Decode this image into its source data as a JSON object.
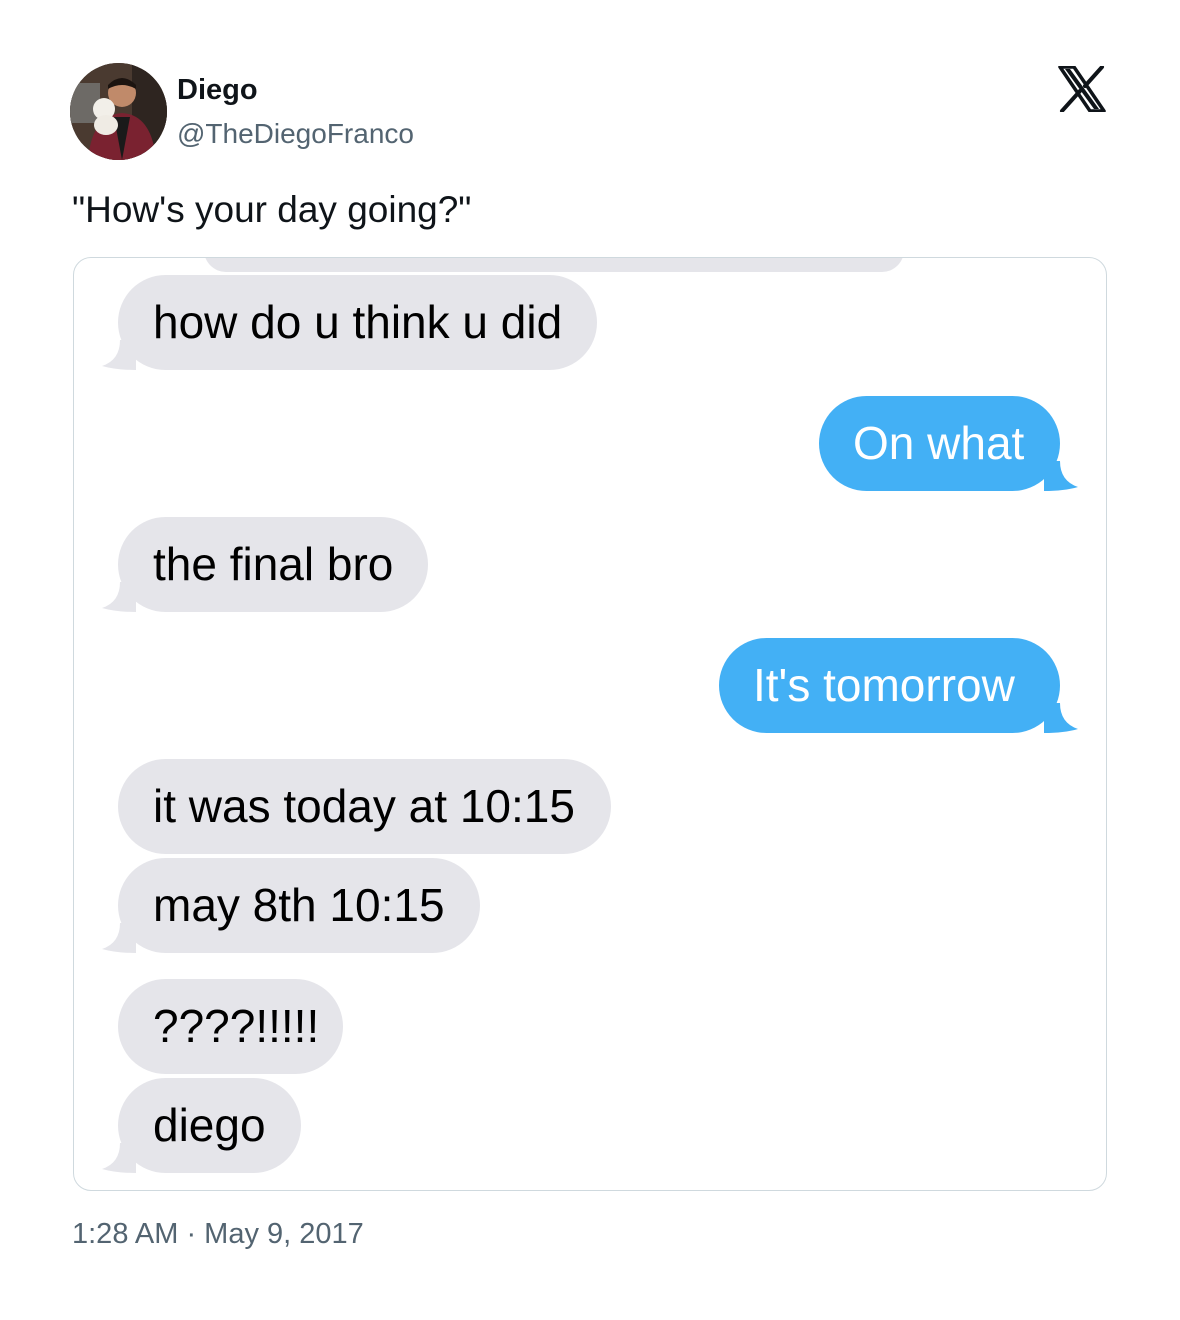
{
  "author": {
    "display_name": "Diego",
    "handle": "@TheDiegoFranco"
  },
  "platform_icon": "x-logo-icon",
  "tweet": {
    "text": "\"How's your day going?\"",
    "timestamp": "1:28 AM · May 9, 2017"
  },
  "conversation": {
    "messages": [
      {
        "sender": "them",
        "text": "how do u think u did"
      },
      {
        "sender": "me",
        "text": "On what"
      },
      {
        "sender": "them",
        "text": "the final bro"
      },
      {
        "sender": "me",
        "text": "It's tomorrow"
      },
      {
        "sender": "them",
        "text": "it was today at 10:15"
      },
      {
        "sender": "them",
        "text": "may 8th 10:15"
      },
      {
        "sender": "them",
        "text": "????!!!!!"
      },
      {
        "sender": "them",
        "text": "diego"
      }
    ]
  },
  "colors": {
    "received_bubble": "#e5e5ea",
    "sent_bubble": "#43b0f5",
    "secondary_text": "#536471"
  }
}
